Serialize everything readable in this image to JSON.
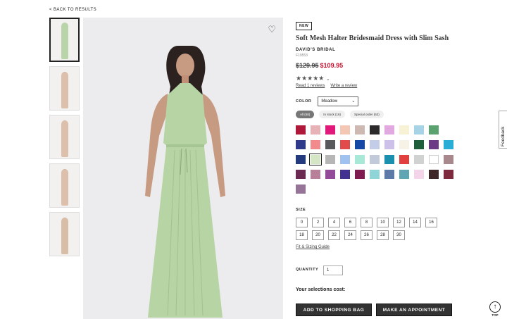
{
  "nav": {
    "back_label": "< BACK TO RESULTS"
  },
  "product": {
    "badge": "NEW",
    "title": "Soft Mesh Halter Bridesmaid Dress with Slim Sash",
    "brand": "DAVID'S BRIDAL",
    "sku": "F19553",
    "old_price": "$129.95",
    "new_price": "$109.95",
    "rating_stars": "★★★★★",
    "reviews_link": "Read 1 reviews",
    "write_review": "Write a review"
  },
  "color": {
    "label": "COLOR",
    "selected": "Meadow",
    "filters": [
      "All (68)",
      "In stock (16)",
      "Special order (62)"
    ],
    "swatches": [
      [
        "#b0183a",
        "#e7b2b5",
        "#e0197a",
        "#f3c7b3",
        "#cdb8b2",
        "#2d2a2c",
        "#e1a9df",
        "#f7f1d5",
        "#a6d3e6",
        "#5aa36e"
      ],
      [
        "#2f3b8a",
        "#f08a8c",
        "#59595b",
        "#e14b4b",
        "#1547a5",
        "#c3cde7",
        "#cdc1ea",
        "#f6f3e6",
        "#1f5e3b",
        "#6d3b86",
        "#2baed6"
      ],
      [
        "#233a7c",
        "#d4e6c3",
        "#b6b6b6",
        "#9fc2ef",
        "#a7e8d6",
        "#c2c9d8",
        "#1b8fae",
        "#e23f3f",
        "#d0d2d2",
        "#ffffff",
        "#a9888d"
      ],
      [
        "#6a2a52",
        "#b98199",
        "#924a99",
        "#433292",
        "#7e1b51",
        "#8fd5d8",
        "#5d79a7",
        "#5fa5b3",
        "#f4d4e8",
        "#3e2629",
        "#7d2a3e"
      ],
      [
        "#967497"
      ]
    ]
  },
  "size": {
    "label": "SIZE",
    "values": [
      "0",
      "2",
      "4",
      "6",
      "8",
      "10",
      "12",
      "14",
      "16",
      "18",
      "20",
      "22",
      "24",
      "26",
      "28",
      "30"
    ],
    "fit_link": "Fit & Sizing Guide"
  },
  "quantity": {
    "label": "QUANTITY",
    "value": "1"
  },
  "cost": {
    "label": "Your selections cost:"
  },
  "actions": {
    "add_to_bag": "ADD TO SHOPPING BAG",
    "appointment": "MAKE AN APPOINTMENT"
  },
  "widgets": {
    "feedback": "Feedback",
    "top": "TOP",
    "top_icon": "arrow-up-icon"
  }
}
